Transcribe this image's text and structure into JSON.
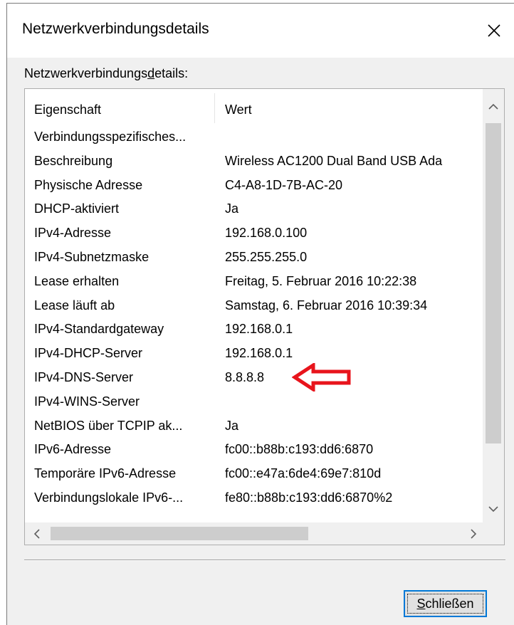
{
  "window": {
    "title": "Netzwerkverbindungsdetails",
    "close_icon": "close-icon"
  },
  "group": {
    "caption": "Netzwerkverbindungsdetails:"
  },
  "table": {
    "columns": [
      "Eigenschaft",
      "Wert"
    ],
    "rows": [
      {
        "property": "Verbindungsspezifisches...",
        "value": ""
      },
      {
        "property": "Beschreibung",
        "value": "Wireless AC1200 Dual Band USB Ada"
      },
      {
        "property": "Physische Adresse",
        "value": "C4-A8-1D-7B-AC-20"
      },
      {
        "property": "DHCP-aktiviert",
        "value": "Ja"
      },
      {
        "property": "IPv4-Adresse",
        "value": "192.168.0.100"
      },
      {
        "property": "IPv4-Subnetzmaske",
        "value": "255.255.255.0"
      },
      {
        "property": "Lease erhalten",
        "value": "Freitag, 5. Februar 2016 10:22:38"
      },
      {
        "property": "Lease läuft ab",
        "value": "Samstag, 6. Februar 2016 10:39:34"
      },
      {
        "property": "IPv4-Standardgateway",
        "value": "192.168.0.1"
      },
      {
        "property": "IPv4-DHCP-Server",
        "value": "192.168.0.1"
      },
      {
        "property": "IPv4-DNS-Server",
        "value": "8.8.8.8"
      },
      {
        "property": "IPv4-WINS-Server",
        "value": ""
      },
      {
        "property": "NetBIOS über TCPIP ak...",
        "value": "Ja"
      },
      {
        "property": "IPv6-Adresse",
        "value": "fc00::b88b:c193:dd6:6870"
      },
      {
        "property": "Temporäre IPv6-Adresse",
        "value": "fc00::e47a:6de4:69e7:810d"
      },
      {
        "property": "Verbindungslokale IPv6-...",
        "value": "fe80::b88b:c193:dd6:6870%2"
      }
    ]
  },
  "annotation": {
    "color": "#e8141c",
    "icon": "red-arrow-icon"
  },
  "footer": {
    "close_button_label": "Schließen"
  },
  "colors": {
    "focus_border": "#0078d7",
    "dialog_bg": "#f0f0f0"
  }
}
